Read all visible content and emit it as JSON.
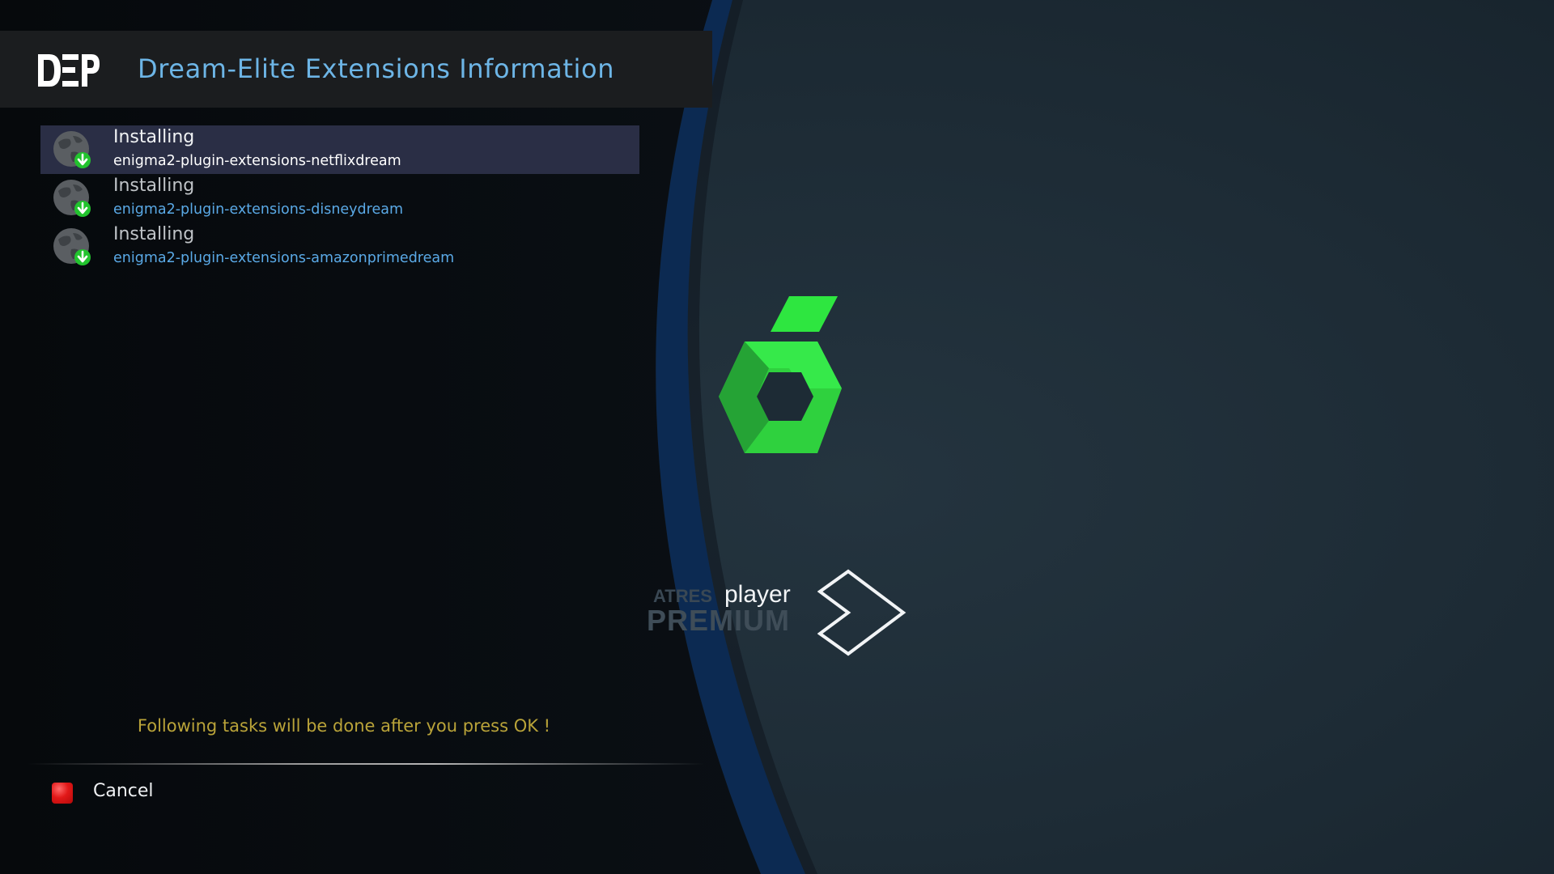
{
  "header": {
    "title": "Dream-Elite Extensions Information",
    "logo_text": "DEP",
    "title_color": "#6db5e6"
  },
  "tasks": [
    {
      "status": "Installing",
      "package": "enigma2-plugin-extensions-netflixdream",
      "icon": "globe-download-icon",
      "selected": true
    },
    {
      "status": "Installing",
      "package": "enigma2-plugin-extensions-disneydream",
      "icon": "globe-download-icon",
      "selected": false
    },
    {
      "status": "Installing",
      "package": "enigma2-plugin-extensions-amazonprimedream",
      "icon": "globe-download-icon",
      "selected": false
    }
  ],
  "package_color": "#5aa9e6",
  "footer": {
    "note": "Following tasks will be done after you press OK !",
    "note_color": "#b9a339"
  },
  "buttons": {
    "cancel_label": "Cancel",
    "cancel_key_color": "#e21818"
  },
  "preview": {
    "channel_logo": "green-hexagon-6-logo",
    "channel_logo_color": "#2ee640",
    "atres_brand": "ATRES",
    "atres_player": "player",
    "atres_premium": "PREMIUM"
  }
}
